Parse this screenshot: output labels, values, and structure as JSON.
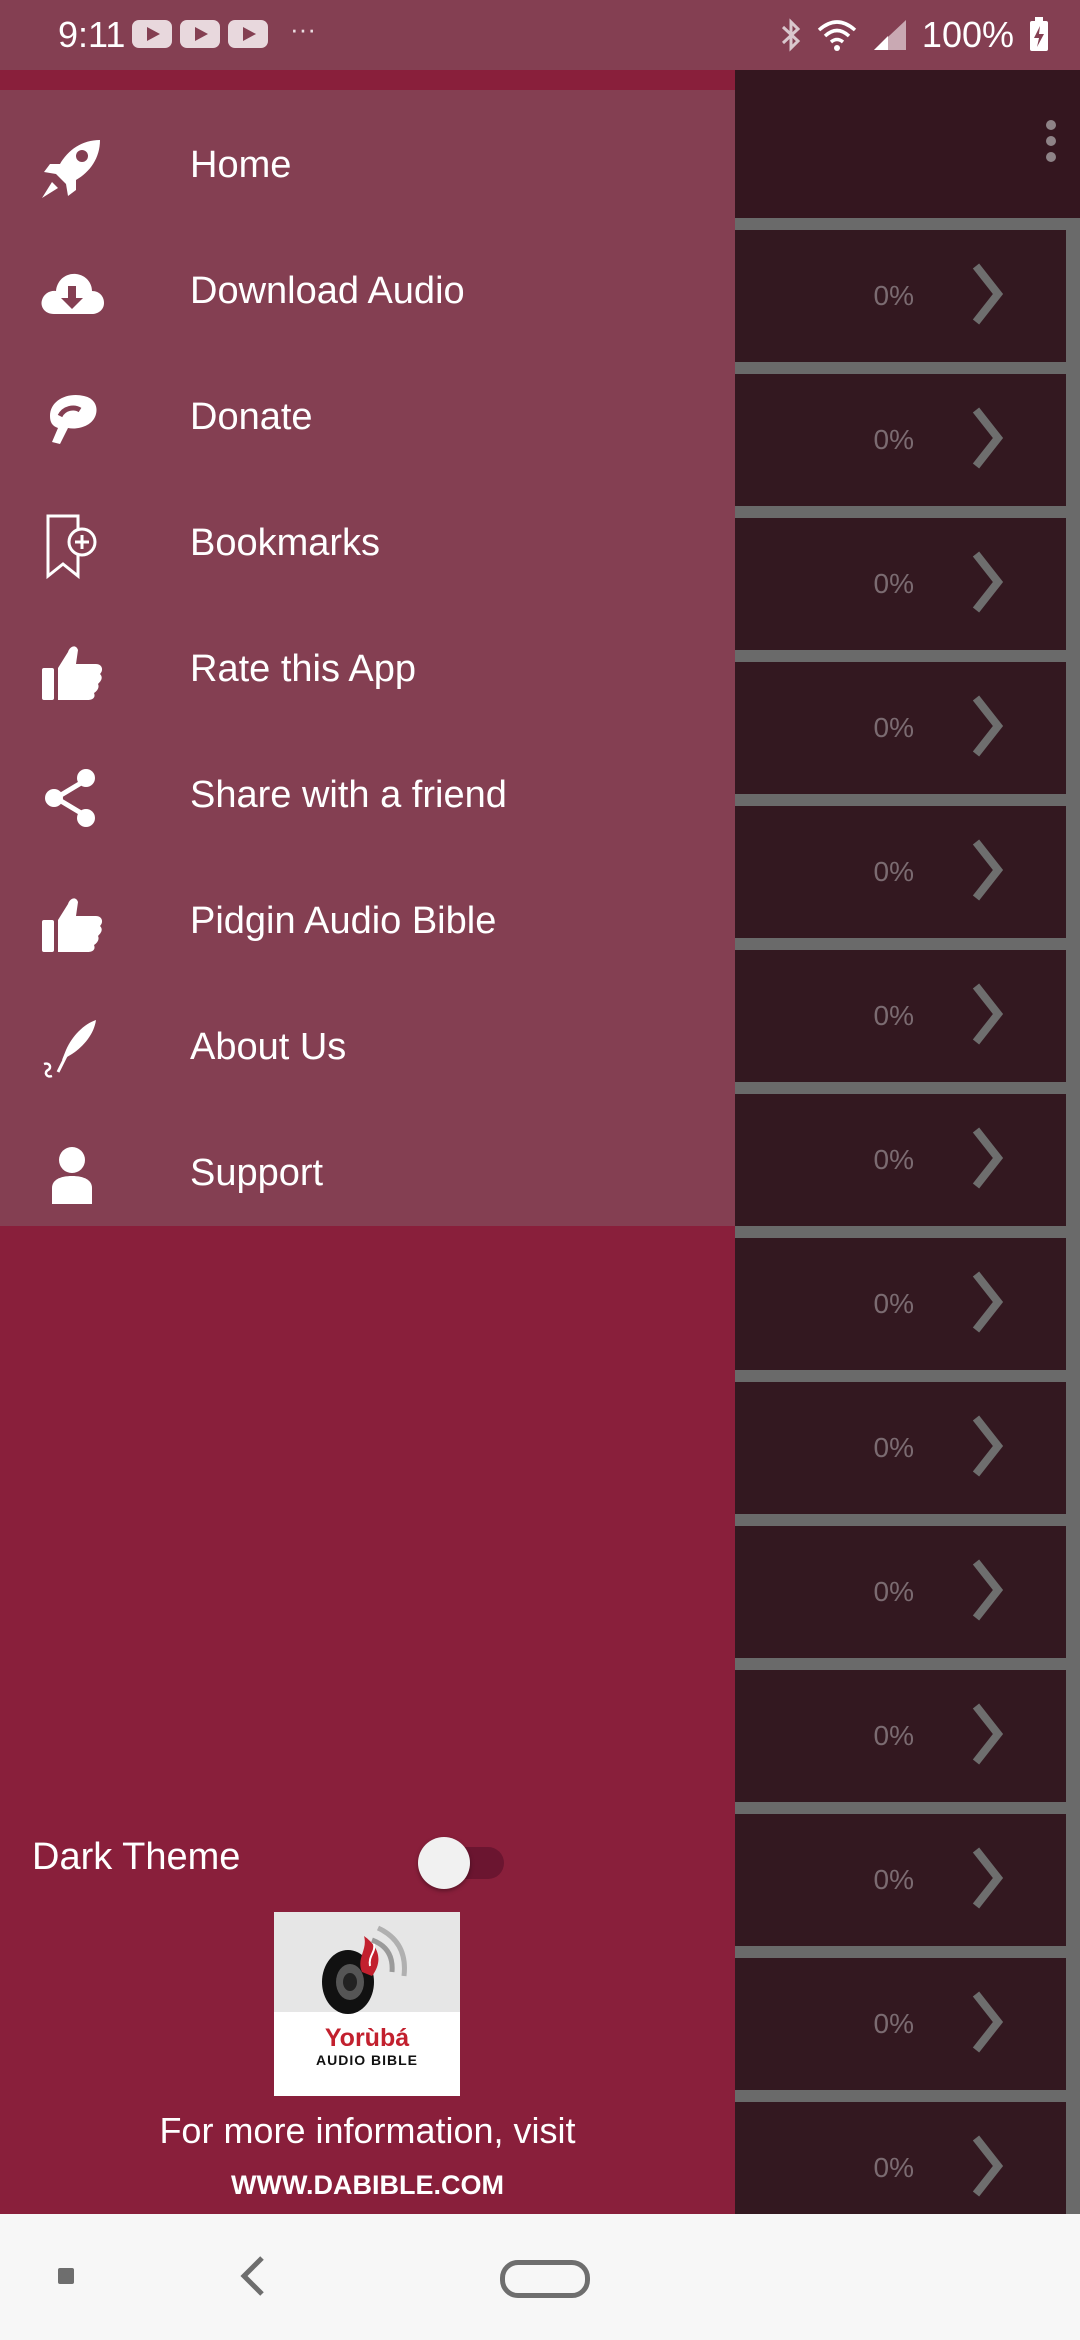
{
  "status_bar": {
    "time": "9:11",
    "notification_icons": [
      "youtube-icon",
      "youtube-icon",
      "youtube-icon"
    ],
    "overflow": "···",
    "battery": "100%"
  },
  "drawer": {
    "menu": [
      {
        "label": "Home",
        "icon": "rocket-icon"
      },
      {
        "label": "Download Audio",
        "icon": "cloud-download-icon"
      },
      {
        "label": "Donate",
        "icon": "donate-icon"
      },
      {
        "label": "Bookmarks",
        "icon": "bookmark-add-icon"
      },
      {
        "label": "Rate this App",
        "icon": "thumbs-up-icon"
      },
      {
        "label": "Share with a friend",
        "icon": "share-icon"
      },
      {
        "label": "Pidgin Audio Bible",
        "icon": "thumbs-up-icon"
      },
      {
        "label": "About Us",
        "icon": "quill-pen-icon"
      },
      {
        "label": "Support",
        "icon": "person-icon"
      }
    ],
    "dark_theme": {
      "label": "Dark Theme",
      "enabled": false
    },
    "logo": {
      "title": "Yorùbá",
      "subtitle": "AUDIO BIBLE"
    },
    "info_text": "For more information, visit",
    "website": "WWW.DABIBLE.COM"
  },
  "background_list": {
    "rows": [
      "0%",
      "0%",
      "0%",
      "0%",
      "0%",
      "0%",
      "0%",
      "0%",
      "0%",
      "0%",
      "0%",
      "0%",
      "0%",
      "0%"
    ]
  },
  "colors": {
    "drawer": "#891f3b",
    "menu": "#843f52",
    "list_row": "#331820"
  }
}
